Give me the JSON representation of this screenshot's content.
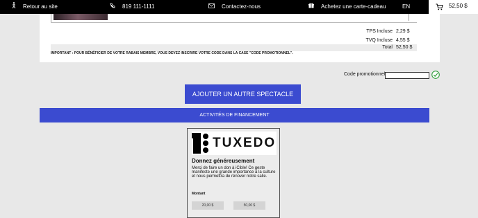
{
  "topbar": {
    "back_label": "Retour au site",
    "phone": "819 111-1111",
    "contact_label": "Contactez-nous",
    "giftcard_label": "Achetez une carte-cadeau",
    "language": "EN",
    "cart_total": "52,50 $"
  },
  "totals": {
    "tps_label": "TPS Incluse",
    "tps_value": "2,29 $",
    "tvq_label": "TVQ Incluse",
    "tvq_value": "4,55 $",
    "total_label": "Total",
    "total_value": "52,50 $"
  },
  "notice": "IMPORTANT : POUR BÉNÉFICIER DE VOTRE RABAIS MEMBRE, VOUS DEVEZ INSCRIRE VOTRE CODE DANS LA CASE \"CODE PROMOTIONNEL\".",
  "promo": {
    "label": "Code promotionnel",
    "value": ""
  },
  "add_show_button": "Ajouter un autre spectacle",
  "fundraising_title": "Activités de financement",
  "donation": {
    "logo_text": "TUXEDO",
    "title": "Donnez généreusement",
    "text": "Merci de faire un don à iCible! Ce geste manifeste une grande importance à la culture et nous permettra de rénover notre salle.",
    "amount_label": "Montant",
    "amounts": [
      "20,00 $",
      "50,00 $"
    ]
  },
  "colors": {
    "accent": "#3b4bd0",
    "check": "#2e9e3a",
    "topbar": "#000000"
  }
}
